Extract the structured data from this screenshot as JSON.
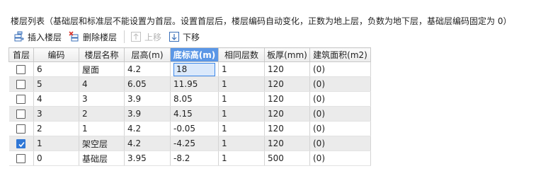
{
  "caption": "楼层列表（基础层和标准层不能设置为首层。设置首层后，楼层编码自动变化，正数为地上层，负数为地下层，基础层编码固定为 0）",
  "toolbar": {
    "insert_label": "插入楼层",
    "delete_label": "删除楼层",
    "up_label": "上移",
    "down_label": "下移"
  },
  "table": {
    "headers": {
      "first": "首层",
      "code": "编码",
      "name": "楼层名称",
      "height": "层高(m)",
      "base": "底标高(m)",
      "same": "相同层数",
      "slab": "板厚(mm)",
      "area": "建筑面积(m2)"
    },
    "rows": [
      {
        "first": false,
        "code": "6",
        "name": "屋面",
        "height": "4.2",
        "base": "18",
        "same": "1",
        "slab": "120",
        "area": "(0)"
      },
      {
        "first": false,
        "code": "5",
        "name": "4",
        "height": "6.05",
        "base": "11.95",
        "same": "1",
        "slab": "120",
        "area": "(0)"
      },
      {
        "first": false,
        "code": "4",
        "name": "3",
        "height": "3.9",
        "base": "8.05",
        "same": "1",
        "slab": "120",
        "area": "(0)"
      },
      {
        "first": false,
        "code": "3",
        "name": "2",
        "height": "3.9",
        "base": "4.15",
        "same": "1",
        "slab": "120",
        "area": "(0)"
      },
      {
        "first": false,
        "code": "2",
        "name": "1",
        "height": "4.2",
        "base": "-0.05",
        "same": "1",
        "slab": "120",
        "area": "(0)"
      },
      {
        "first": true,
        "code": "1",
        "name": "架空层",
        "height": "4.2",
        "base": "-4.25",
        "same": "1",
        "slab": "120",
        "area": "(0)"
      },
      {
        "first": false,
        "code": "0",
        "name": "基础层",
        "height": "3.95",
        "base": "-8.2",
        "same": "1",
        "slab": "500",
        "area": "(0)"
      }
    ]
  },
  "colors": {
    "header_highlight": "#5b97e6",
    "checkbox_checked": "#2f77d6",
    "alt_row": "#ebebeb",
    "edit_cell": "#dbe9fb"
  }
}
